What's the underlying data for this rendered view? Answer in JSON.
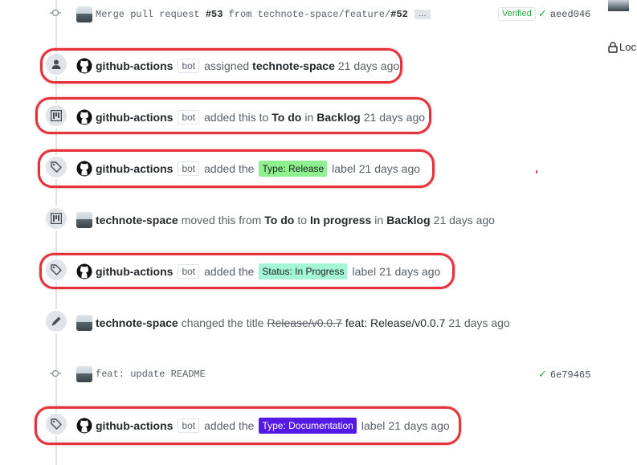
{
  "top_commit": {
    "message_prefix": "Merge pull request ",
    "pr_number": "#53",
    "message_middle": " from technote-space/feature/",
    "branch_number": "#52",
    "ellipsis": "…",
    "verified": "Verified",
    "check": "✓",
    "sha": "aeed046"
  },
  "sidebar": {
    "lock_label": "Lock"
  },
  "events": [
    {
      "author": "github-actions",
      "bot": "bot",
      "text1": "assigned",
      "strong1": "technote-space",
      "time": "21 days ago"
    },
    {
      "author": "github-actions",
      "bot": "bot",
      "text1": "added this to",
      "strong1": "To do",
      "text2": "in",
      "strong2": "Backlog",
      "time": "21 days ago"
    },
    {
      "author": "github-actions",
      "bot": "bot",
      "text1": "added the",
      "label": "Type: Release",
      "text2": "label",
      "time": "21 days ago"
    },
    {
      "author": "technote-space",
      "text1": "moved this from",
      "strong1": "To do",
      "text2": "to",
      "strong2": "In progress",
      "text3": "in",
      "strong3": "Backlog",
      "time": "21 days ago"
    },
    {
      "author": "github-actions",
      "bot": "bot",
      "text1": "added the",
      "label": "Status: In Progress",
      "text2": "label",
      "time": "21 days ago"
    },
    {
      "author": "technote-space",
      "text1": "changed the title",
      "old_title": "Release/v0.0.7",
      "new_title": "feat: Release/v0.0.7",
      "time": "21 days ago"
    },
    {
      "author": "github-actions",
      "bot": "bot",
      "text1": "added the",
      "label": "Type: Documentation",
      "text2": "label",
      "time": "21 days ago"
    }
  ],
  "second_commit": {
    "message": "feat: update README",
    "check": "✓",
    "sha": "6e79465"
  },
  "colors": {
    "type_release_bg": "#8ef08e",
    "status_in_progress_bg": "#a4f5d3",
    "type_documentation_bg": "#5319e7",
    "annotation": "#e3323a",
    "verified_green": "#28a745"
  },
  "icons": {
    "assign": "person-icon",
    "project": "project-icon",
    "label": "tag-icon",
    "rename": "pencil-icon",
    "commit": "git-commit-icon",
    "lock": "lock-icon",
    "bot_avatar": "github-logo-icon"
  }
}
